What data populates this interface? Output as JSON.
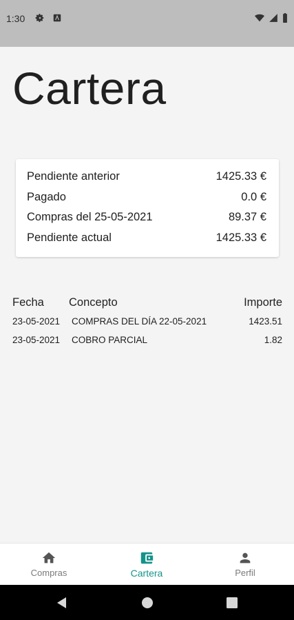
{
  "status_bar": {
    "time": "1:30",
    "icons": [
      "gear-icon",
      "card-icon",
      "wifi-icon",
      "signal-icon",
      "battery-icon"
    ]
  },
  "page": {
    "title": "Cartera"
  },
  "summary": {
    "rows": [
      {
        "label": "Pendiente anterior",
        "value": "1425.33 €"
      },
      {
        "label": "Pagado",
        "value": "0.0 €"
      },
      {
        "label": "Compras del 25-05-2021",
        "value": "89.37 €"
      },
      {
        "label": "Pendiente actual",
        "value": "1425.33 €"
      }
    ]
  },
  "movements": {
    "headers": {
      "date": "Fecha",
      "concept": "Concepto",
      "amount": "Importe"
    },
    "rows": [
      {
        "date": "23-05-2021",
        "concept": "COMPRAS DEL DÍA 22-05-2021",
        "amount": "1423.51"
      },
      {
        "date": "23-05-2021",
        "concept": "COBRO PARCIAL",
        "amount": "1.82"
      }
    ]
  },
  "bottom_nav": {
    "items": [
      {
        "label": "Compras",
        "icon": "home-icon"
      },
      {
        "label": "Cartera",
        "icon": "wallet-icon",
        "active": true
      },
      {
        "label": "Perfil",
        "icon": "person-icon"
      }
    ]
  },
  "colors": {
    "accent": "#14938a",
    "status_bar": "#bdbdbd",
    "background": "#f4f4f4"
  }
}
